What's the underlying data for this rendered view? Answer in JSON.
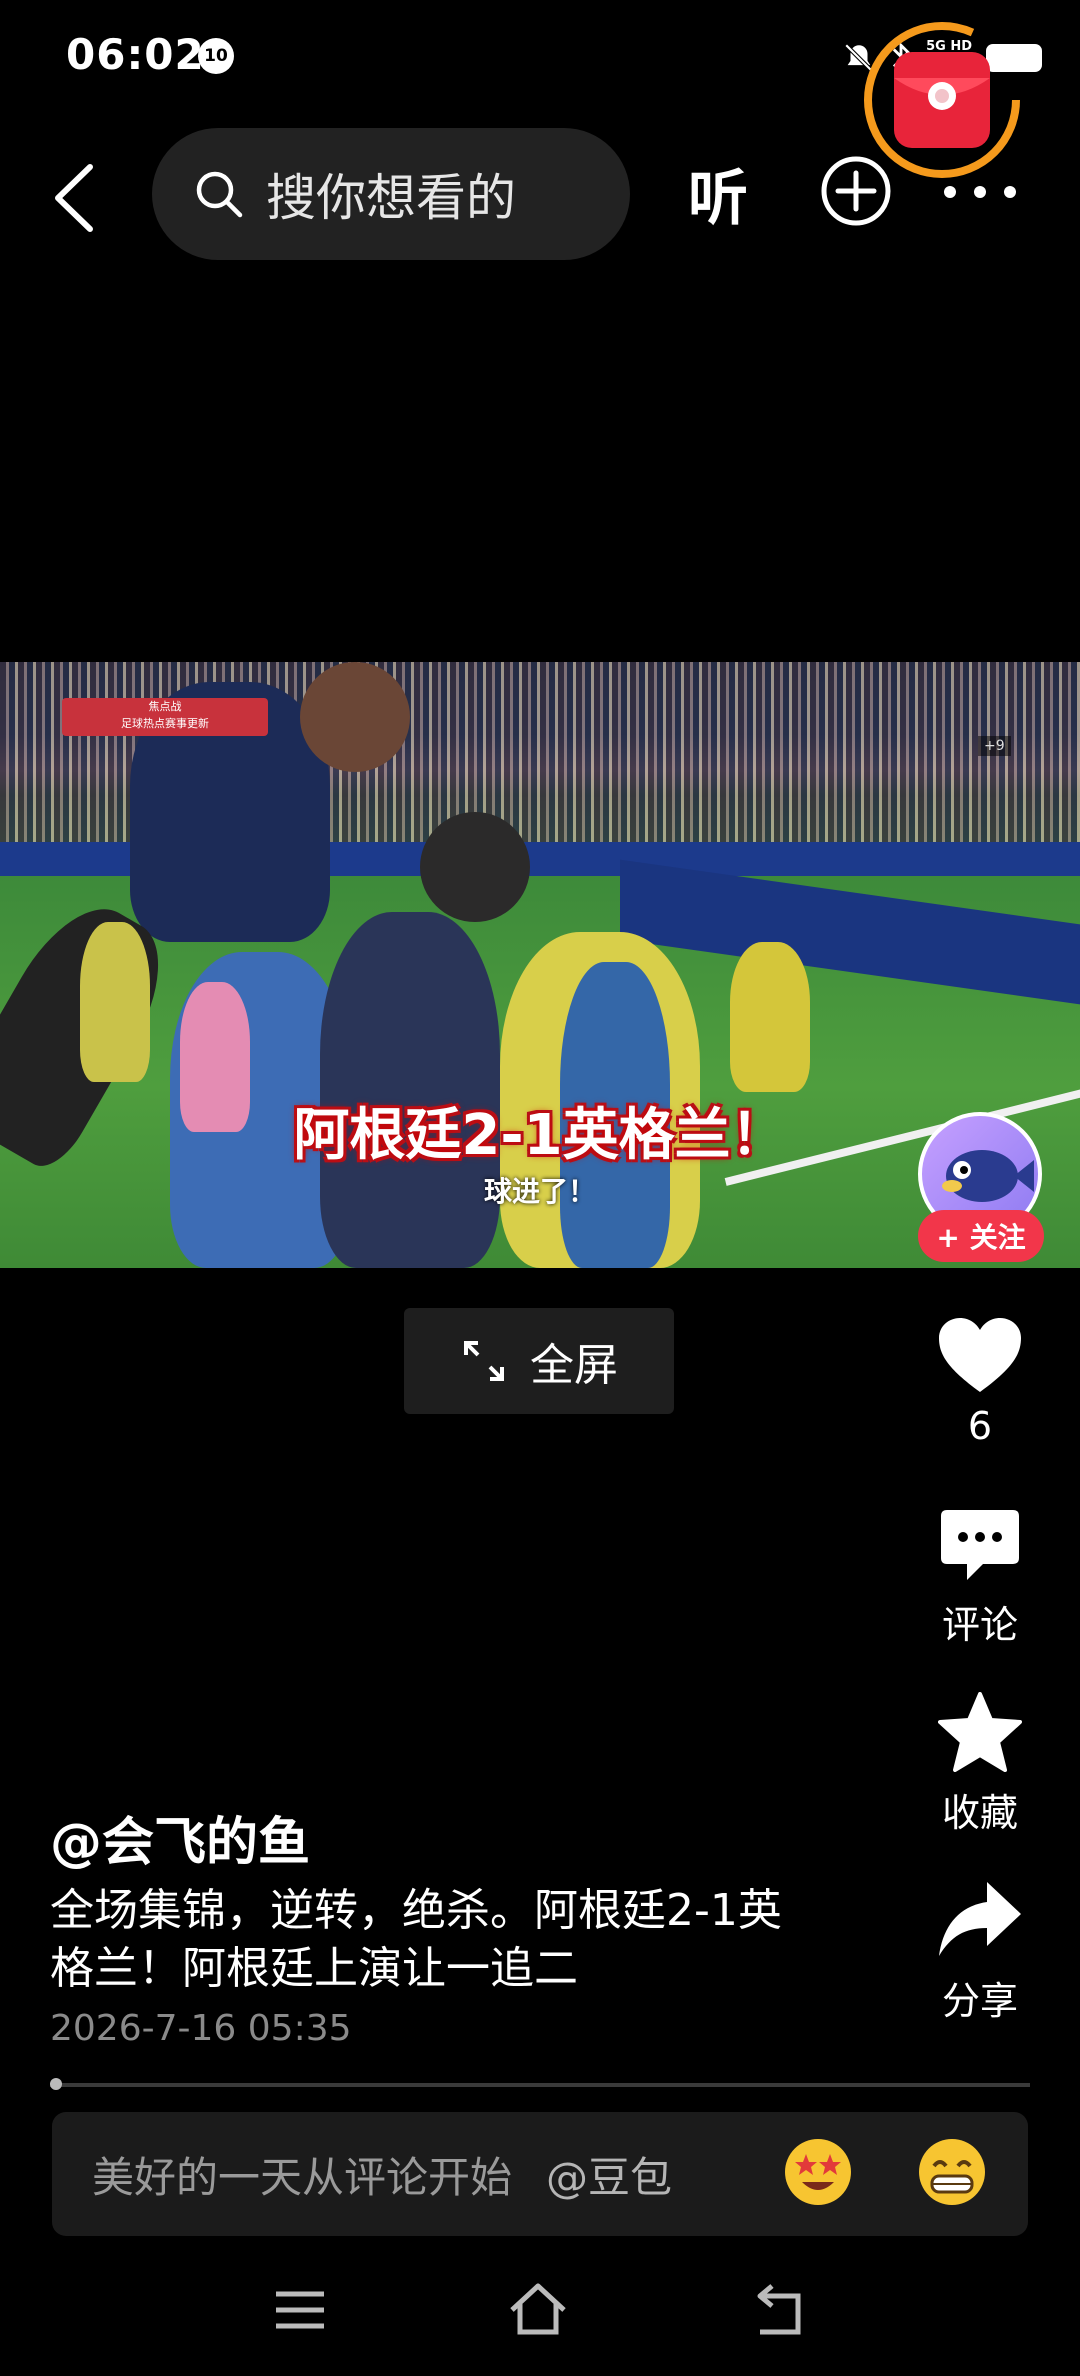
{
  "status_bar": {
    "time": "06:02",
    "notification_badge": "10",
    "network_label_top": "5G HD",
    "icons": [
      "bell-muted-icon",
      "bluetooth-icon",
      "signal-icon",
      "battery-icon"
    ]
  },
  "top_bar": {
    "search_placeholder": "搜你想看的",
    "listen_label": "听",
    "icons": [
      "back-arrow-icon",
      "search-icon",
      "add-circle-icon",
      "more-icon"
    ]
  },
  "video": {
    "overlay_tag_line1": "焦点战",
    "overlay_tag_line2": "足球热点赛事更新",
    "badge": "+9",
    "caption_main": "阿根廷2-1英格兰！",
    "caption_sub": "球进了！"
  },
  "follow": {
    "label": "+ 关注"
  },
  "fullscreen": {
    "label": "全屏"
  },
  "actions": {
    "like_count": "6",
    "comment_label": "评论",
    "favorite_label": "收藏",
    "share_label": "分享"
  },
  "post": {
    "author": "@会飞的鱼",
    "description": "全场集锦，逆转，绝杀。阿根廷2-1英格兰！阿根廷上演让一追二",
    "timestamp": "2026-7-16 05:35"
  },
  "playback": {
    "progress_fraction": 0.0
  },
  "comment_bar": {
    "placeholder": "美好的一天从评论开始",
    "mention_label": "@豆包"
  },
  "colors": {
    "background": "#000000",
    "follow_red": "#f2364a",
    "caption_red": "#b5121b",
    "red_packet_ring": "#f59a1c"
  }
}
